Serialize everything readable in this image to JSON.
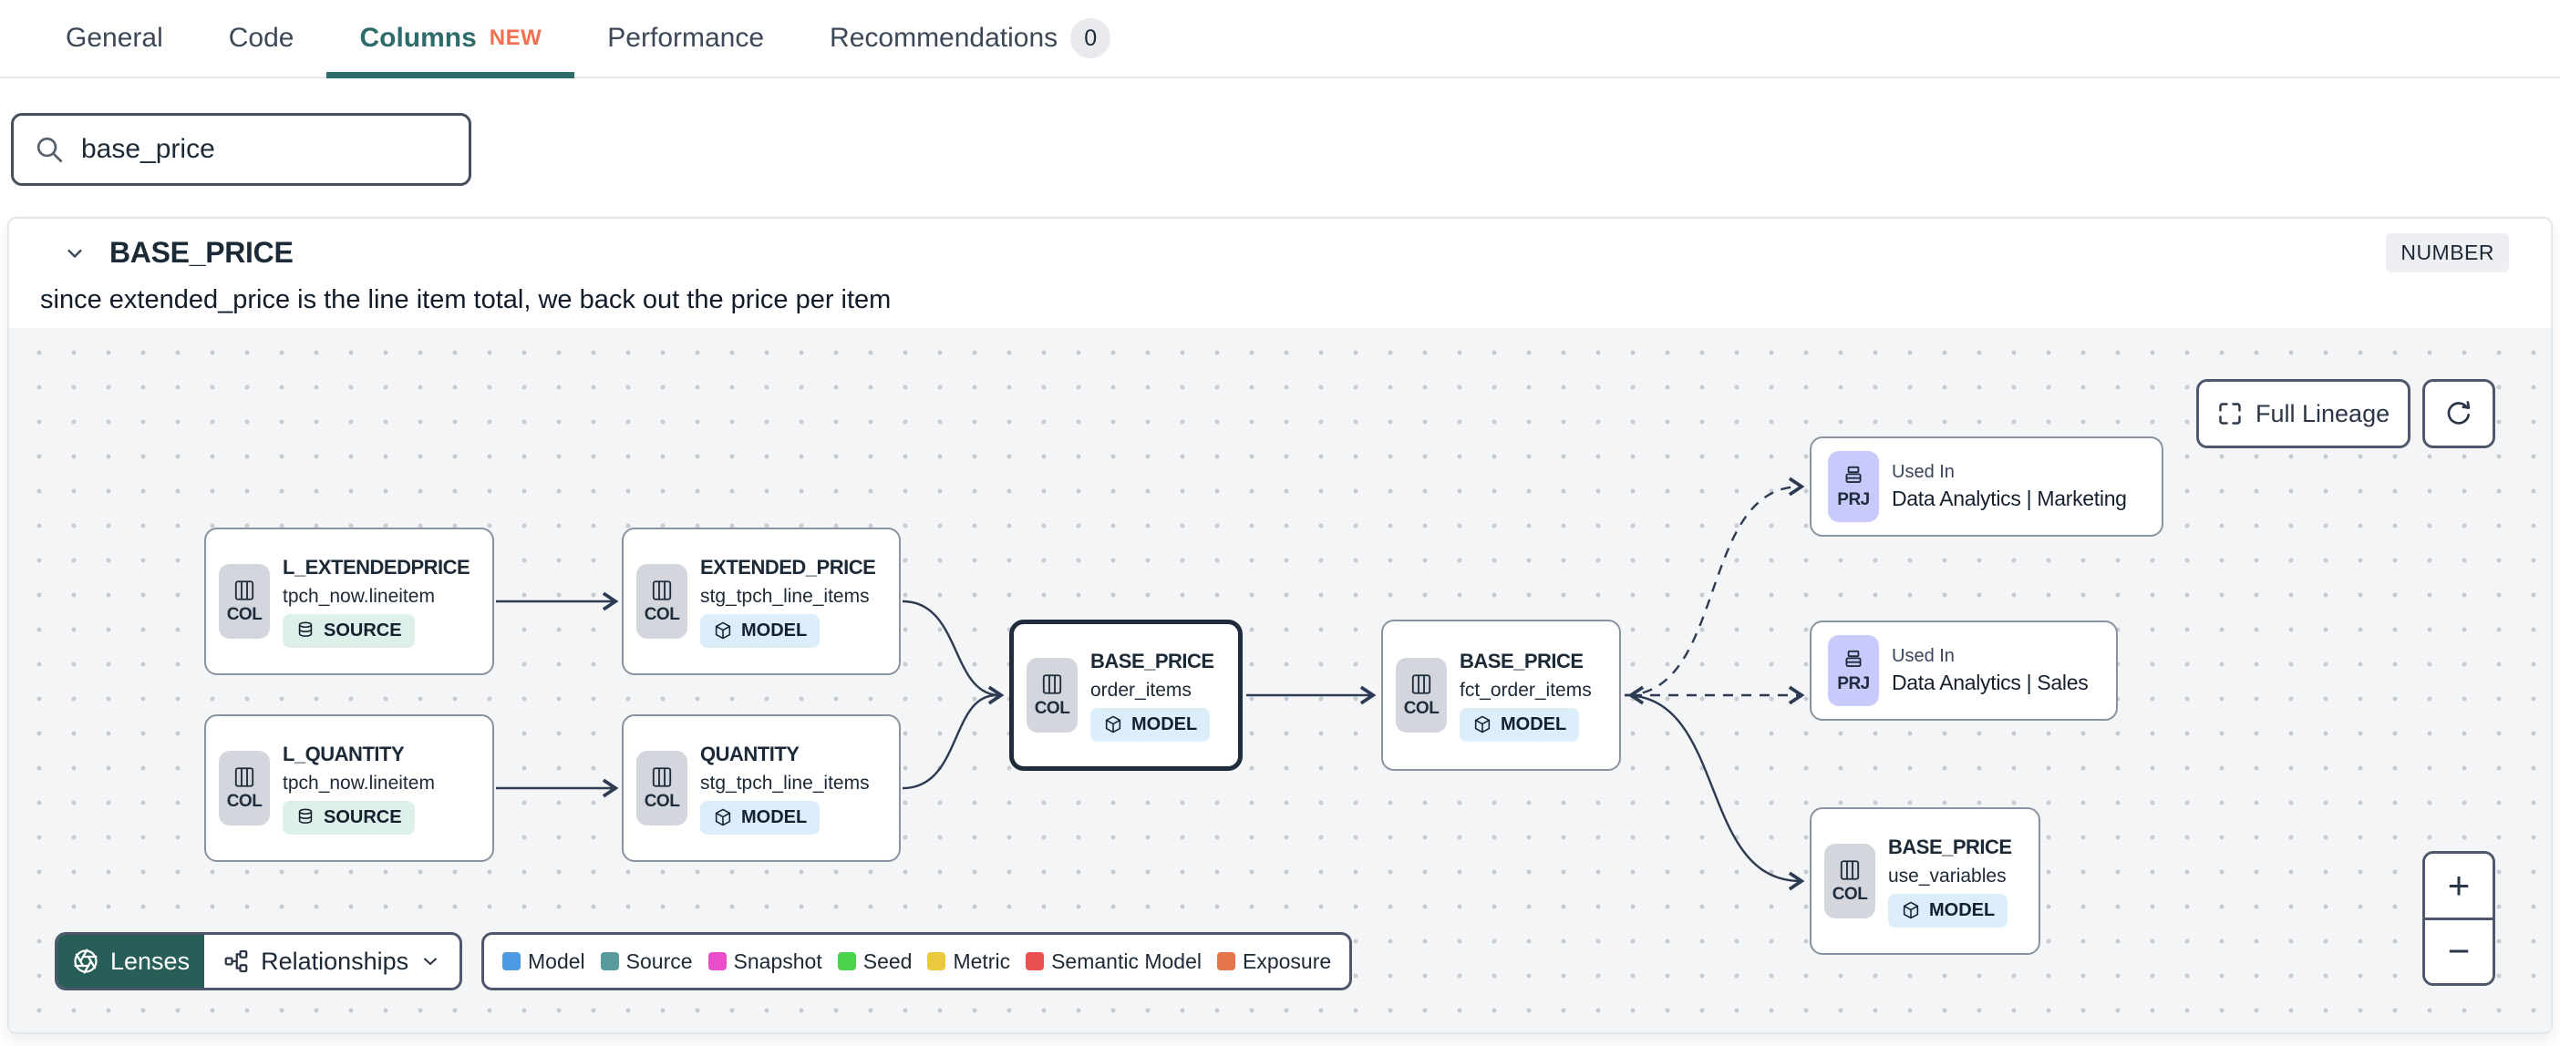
{
  "tabs": {
    "general": "General",
    "code": "Code",
    "columns": "Columns",
    "columns_new_badge": "NEW",
    "performance": "Performance",
    "recommendations": "Recommendations",
    "recommendations_count": "0",
    "active_tab": "Columns",
    "accent_color": "#2e6b6b",
    "new_badge_color": "#f26f51"
  },
  "search": {
    "value": "base_price"
  },
  "column_header": {
    "name": "BASE_PRICE",
    "data_type": "NUMBER",
    "description": "since extended_price is the line item total, we back out the price per item"
  },
  "lineage": {
    "controls": {
      "full_lineage": "Full Lineage",
      "zoom_in": "+",
      "zoom_out": "−"
    },
    "toolbar": {
      "lenses": "Lenses",
      "relationships": "Relationships"
    },
    "legend": {
      "items": [
        {
          "label": "Model",
          "color": "#4f9be3"
        },
        {
          "label": "Source",
          "color": "#579b9b"
        },
        {
          "label": "Snapshot",
          "color": "#ea4ecb"
        },
        {
          "label": "Seed",
          "color": "#4ad44a"
        },
        {
          "label": "Metric",
          "color": "#eac93f"
        },
        {
          "label": "Semantic Model",
          "color": "#ea5050"
        },
        {
          "label": "Exposure",
          "color": "#e4764a"
        }
      ]
    },
    "nodes": [
      {
        "icon_label": "COL",
        "title": "L_EXTENDEDPRICE",
        "subtitle": "tpch_now.lineitem",
        "kind": "SOURCE"
      },
      {
        "icon_label": "COL",
        "title": "EXTENDED_PRICE",
        "subtitle": "stg_tpch_line_items",
        "kind": "MODEL"
      },
      {
        "icon_label": "COL",
        "title": "L_QUANTITY",
        "subtitle": "tpch_now.lineitem",
        "kind": "SOURCE"
      },
      {
        "icon_label": "COL",
        "title": "QUANTITY",
        "subtitle": "stg_tpch_line_items",
        "kind": "MODEL"
      },
      {
        "icon_label": "COL",
        "title": "BASE_PRICE",
        "subtitle": "order_items",
        "kind": "MODEL",
        "selected": true
      },
      {
        "icon_label": "COL",
        "title": "BASE_PRICE",
        "subtitle": "fct_order_items",
        "kind": "MODEL"
      },
      {
        "icon_label": "PRJ",
        "used_in_label": "Used In",
        "title": "Data Analytics | Marketing"
      },
      {
        "icon_label": "PRJ",
        "used_in_label": "Used In",
        "title": "Data Analytics | Sales"
      },
      {
        "icon_label": "COL",
        "title": "BASE_PRICE",
        "subtitle": "use_variables",
        "kind": "MODEL"
      }
    ]
  }
}
